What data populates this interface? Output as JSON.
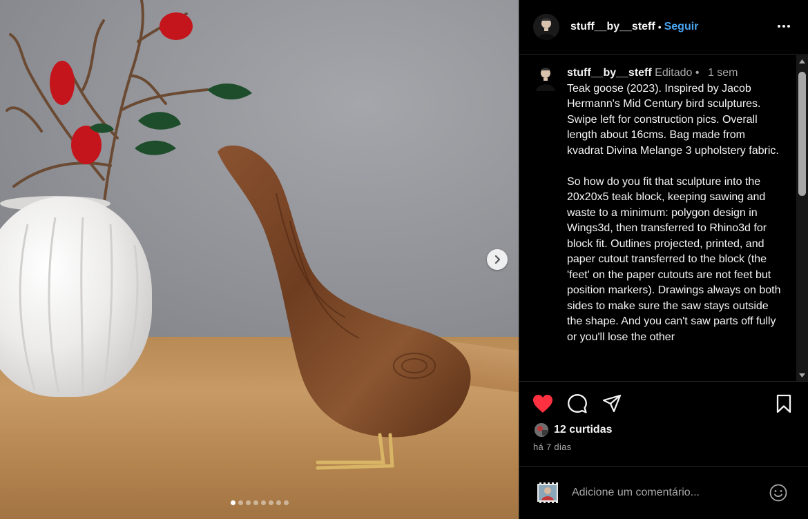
{
  "post": {
    "username": "stuff__by__steff",
    "separator": "•",
    "follow_label": "Seguir",
    "more_icon": "more-horizontal-icon",
    "caption": {
      "username": "stuff__by__steff",
      "edited_label": "Editado",
      "meta_separator": "•",
      "age": "1 sem",
      "text": "Teak goose (2023). Inspired by Jacob Hermann's Mid Century bird sculptures. Swipe left for construction pics. Overall length about 16cms. Bag made from kvadrat Divina Melange 3 upholstery fabric.\n\nSo how do you fit that sculpture into the 20x20x5 teak block, keeping sawing and waste to a minimum: polygon design in Wings3d, then transferred to Rhino3d for block fit. Outlines projected, printed, and paper cutout transferred to the block (the 'feet' on the paper cutouts are not feet but position markers). Drawings always on both sides to make sure the saw stays outside the shape. And you can't saw parts off fully or you'll lose the other"
    },
    "likes_label": "12 curtidas",
    "time_label": "há 7 dias",
    "comment_placeholder": "Adicione um comentário...",
    "carousel": {
      "total": 8,
      "current": 1
    },
    "colors": {
      "like": "#ff3040",
      "follow": "#4aa5f0",
      "background": "#000000",
      "muted": "#a8a8a8"
    }
  }
}
